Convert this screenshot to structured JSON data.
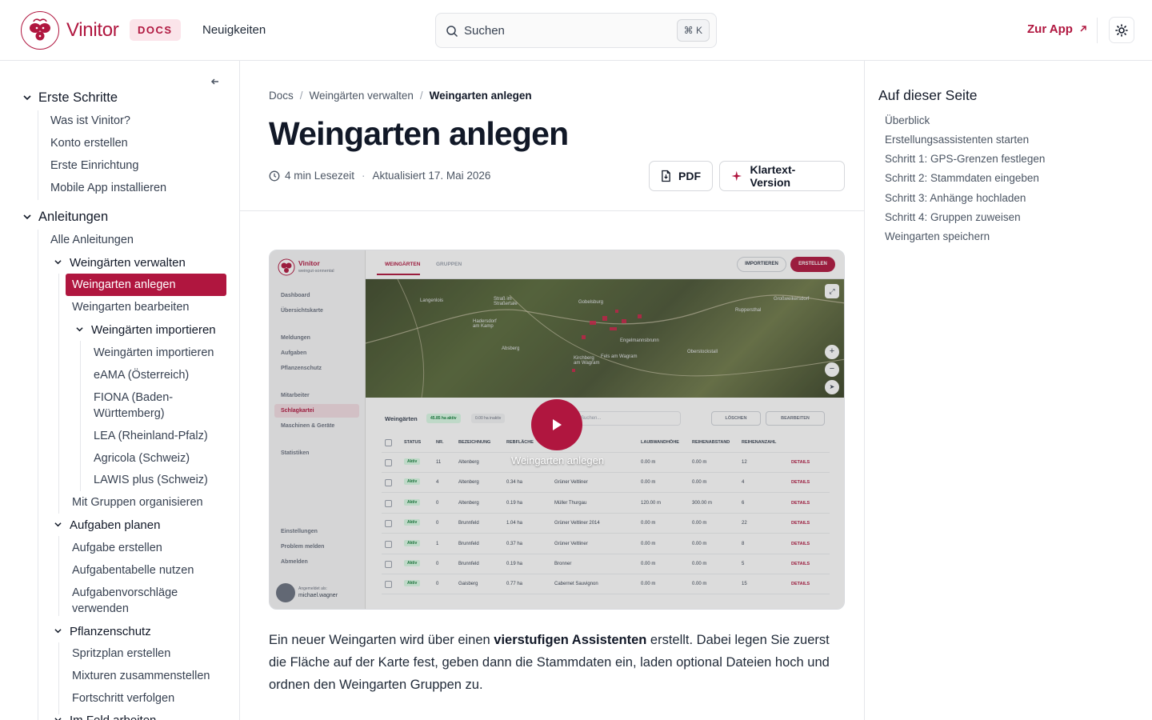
{
  "header": {
    "brand": "Vinitor",
    "docs_badge": "DOCS",
    "news": "Neuigkeiten",
    "search_placeholder": "Suchen",
    "search_shortcut": "⌘ K",
    "zur_app": "Zur App",
    "colors": {
      "accent": "#b0163f",
      "badge_bg": "#fbe4ea"
    }
  },
  "sidebar": {
    "sections": [
      {
        "label": "Erste Schritte",
        "items": [
          "Was ist Vinitor?",
          "Konto erstellen",
          "Erste Einrichtung",
          "Mobile App installieren"
        ]
      },
      {
        "label": "Anleitungen",
        "items": [
          "Alle Anleitungen"
        ]
      }
    ],
    "weingaerten_verwalten": "Weingärten verwalten",
    "wv_items": [
      "Weingarten anlegen",
      "Weingarten bearbeiten"
    ],
    "weingaerten_importieren": "Weingärten importieren",
    "wi_items": [
      "Weingärten importieren",
      "eAMA (Österreich)",
      "FIONA (Baden-",
      "Württemberg)",
      "LEA (Rheinland-Pfalz)",
      "Agricola (Schweiz)",
      "LAWIS plus (Schweiz)"
    ],
    "mit_gruppen": "Mit Gruppen organisieren",
    "aufgaben_planen": "Aufgaben planen",
    "ap_items": [
      "Aufgabe erstellen",
      "Aufgabentabelle nutzen",
      "Aufgabenvorschläge",
      "verwenden"
    ],
    "pflanzenschutz": "Pflanzenschutz",
    "ps_items": [
      "Spritzplan erstellen",
      "Mixturen zusammenstellen",
      "Fortschritt verfolgen"
    ],
    "im_feld": "Im Feld arbeiten"
  },
  "main": {
    "breadcrumb": [
      "Docs",
      "Weingärten verwalten",
      "Weingarten anlegen"
    ],
    "title": "Weingarten anlegen",
    "read_time": "4 min Lesezeit",
    "updated": "Aktualisiert 17. Mai 2026",
    "pdf_label": "PDF",
    "plain_label": "Klartext-Version",
    "video_title": "Weingarten anlegen",
    "para_1": "Ein neuer Weingarten wird über einen ",
    "para_bold": "vierstufigen Assistenten",
    "para_2": " erstellt. Dabei legen Sie zuerst die Fläche auf der Karte fest, geben dann die Stammdaten ein, laden optional Dateien hoch und ordnen den Weingarten Gruppen zu."
  },
  "video_app": {
    "brand": "Vinitor",
    "sub": "weingut-sonnental",
    "tab_weingaerten": "WEINGÄRTEN",
    "tab_gruppen": "GRUPPEN",
    "btn_import": "IMPORTIEREN",
    "btn_create": "ERSTELLEN",
    "nav": [
      "Dashboard",
      "Übersichtskarte",
      "Meldungen",
      "Aufgaben",
      "Pflanzenschutz",
      "Mitarbeiter",
      "Schlagkartei",
      "Maschinen & Geräte",
      "Statistiken",
      "Einstellungen",
      "Problem melden",
      "Abmelden"
    ],
    "user_label": "Angemeldet als:",
    "user": "michael.wagner",
    "table_title": "Weingärten",
    "chip_active": "45.85 ha aktiv",
    "chip_inactive": "0.00 ha inaktiv",
    "search": "Suchen...",
    "btn_delete": "LÖSCHEN",
    "btn_edit": "BEARBEITEN",
    "columns": [
      "STATUS",
      "NR.",
      "BEZEICHNUNG",
      "REBFLÄCHE",
      "SORTE",
      "LAUBWANDHÖHE",
      "REIHENABSTAND",
      "REIHENANZAHL"
    ],
    "rows": [
      [
        "Aktiv",
        "11",
        "Altenberg",
        "",
        "",
        "0.00 m",
        "0.00 m",
        "12"
      ],
      [
        "Aktiv",
        "4",
        "Altenberg",
        "0.34 ha",
        "Grüner Veltliner",
        "0.00 m",
        "0.00 m",
        "4"
      ],
      [
        "Aktiv",
        "0",
        "Altenberg",
        "0.19 ha",
        "Müller Thurgau",
        "120.00 m",
        "300.00 m",
        "6"
      ],
      [
        "Aktiv",
        "0",
        "Brunnfeld",
        "1.04 ha",
        "Grüner Veltliner 2014",
        "0.00 m",
        "0.00 m",
        "22"
      ],
      [
        "Aktiv",
        "1",
        "Brunnfeld",
        "0.37 ha",
        "Grüner Veltliner",
        "0.00 m",
        "0.00 m",
        "8"
      ],
      [
        "Aktiv",
        "0",
        "Brunnfeld",
        "0.19 ha",
        "Bronner",
        "0.00 m",
        "0.00 m",
        "5"
      ],
      [
        "Aktiv",
        "0",
        "Gaisberg",
        "0.77 ha",
        "Cabernet Sauvignon",
        "0.00 m",
        "0.00 m",
        "15"
      ]
    ],
    "details": "DETAILS",
    "map_places": [
      "Langenlois",
      "Straß im Straßertale",
      "Gobelsburg",
      "Hadersdorf am Kamp",
      "Kirchberg am Wagram",
      "Absberg",
      "Fels am Wagram",
      "Großweikersdorf",
      "Ruppersthal",
      "Oberstockstall",
      "Engelmannsbrunn"
    ]
  },
  "toc": {
    "title": "Auf dieser Seite",
    "items": [
      "Überblick",
      "Erstellungsassistenten starten",
      "Schritt 1: GPS-Grenzen festlegen",
      "Schritt 2: Stammdaten eingeben",
      "Schritt 3: Anhänge hochladen",
      "Schritt 4: Gruppen zuweisen",
      "Weingarten speichern"
    ]
  }
}
